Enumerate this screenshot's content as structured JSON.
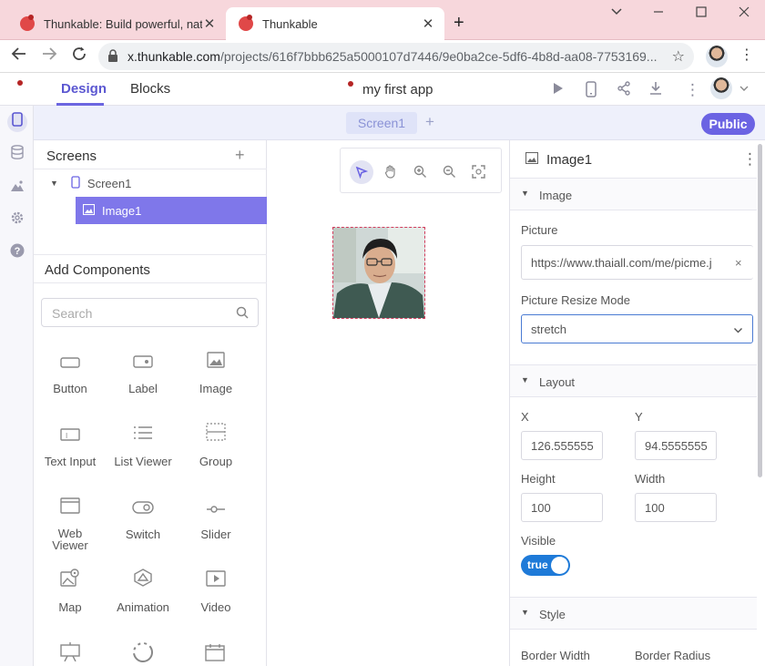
{
  "browser": {
    "tabs": [
      {
        "title": "Thunkable: Build powerful, native",
        "active": false
      },
      {
        "title": "Thunkable",
        "active": true
      }
    ],
    "new_tab": "+",
    "window_controls": [
      "chevron-down",
      "minimize",
      "maximize",
      "close"
    ],
    "url_host": "x.thunkable.com",
    "url_path": "/projects/616f7bbb625a5000107d7446/9e0ba2ce-5df6-4b8d-aa08-7753169..."
  },
  "app": {
    "nav_tabs": {
      "design": "Design",
      "blocks": "Blocks"
    },
    "project_name": "my first app",
    "header_icons": [
      "play-icon",
      "phone-preview-icon",
      "share-icon",
      "download-icon",
      "more-icon"
    ],
    "screen_tab": "Screen1",
    "add_screen": "+",
    "public_button": "Public",
    "rail_icons": [
      "phone-icon",
      "database-icon",
      "assets-icon",
      "settings-icon",
      "help-icon"
    ]
  },
  "left_panel": {
    "screens_title": "Screens",
    "screens_add": "+",
    "tree": {
      "screen": "Screen1",
      "component": "Image1"
    },
    "add_components_title": "Add Components",
    "search_placeholder": "Search",
    "components": [
      {
        "label": "Button",
        "icon": "button-icon"
      },
      {
        "label": "Label",
        "icon": "label-icon"
      },
      {
        "label": "Image",
        "icon": "image-icon"
      },
      {
        "label": "Text Input",
        "icon": "text-input-icon"
      },
      {
        "label": "List Viewer",
        "icon": "list-viewer-icon"
      },
      {
        "label": "Group",
        "icon": "group-icon"
      },
      {
        "label": "Web Viewer",
        "icon": "web-viewer-icon"
      },
      {
        "label": "Switch",
        "icon": "switch-icon"
      },
      {
        "label": "Slider",
        "icon": "slider-icon"
      },
      {
        "label": "Map",
        "icon": "map-icon"
      },
      {
        "label": "Animation",
        "icon": "animation-icon"
      },
      {
        "label": "Video",
        "icon": "video-icon"
      }
    ]
  },
  "canvas": {
    "tools": [
      "select-icon",
      "pan-icon",
      "zoom-in-icon",
      "zoom-out-icon",
      "fit-icon"
    ]
  },
  "properties": {
    "component_name": "Image1",
    "image_section": "Image",
    "picture_label": "Picture",
    "picture_value": "https://www.thaiall.com/me/picme.j",
    "clear": "×",
    "resize_label": "Picture Resize Mode",
    "resize_value": "stretch",
    "layout_section": "Layout",
    "x_label": "X",
    "x_value": "126.555555",
    "y_label": "Y",
    "y_value": "94.5555555",
    "height_label": "Height",
    "height_value": "100",
    "width_label": "Width",
    "width_value": "100",
    "visible_label": "Visible",
    "visible_value": "true",
    "style_section": "Style",
    "border_width_label": "Border Width",
    "border_radius_label": "Border Radius"
  }
}
